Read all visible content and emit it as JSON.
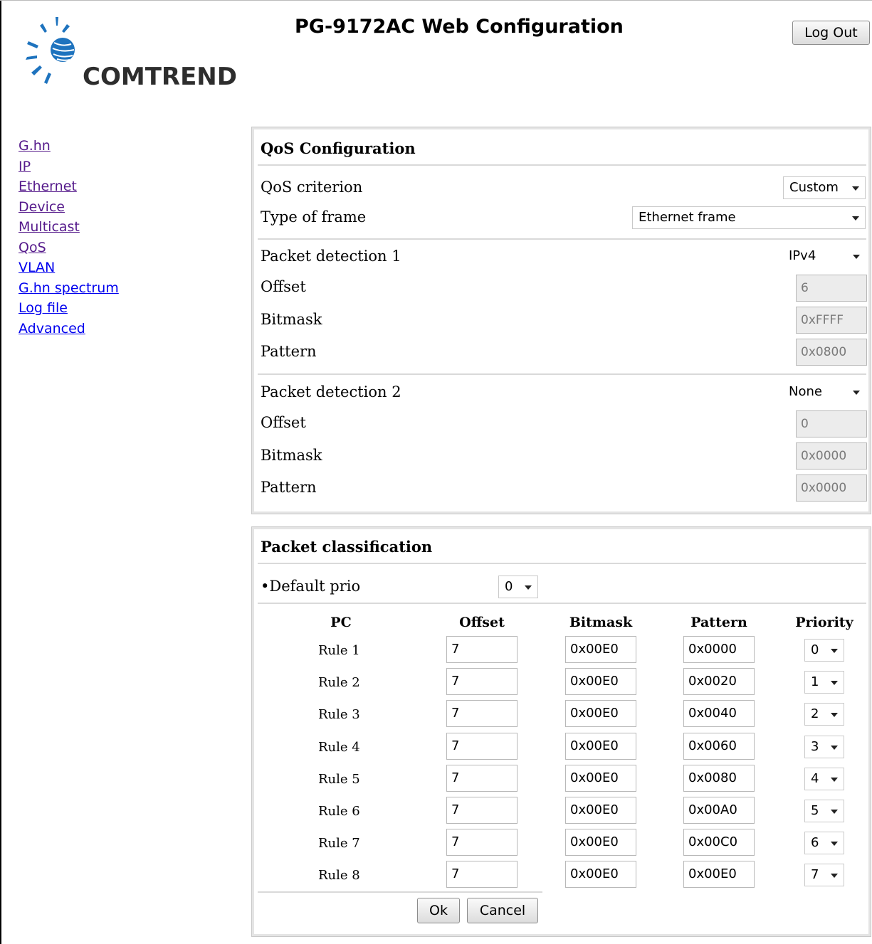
{
  "header": {
    "brand": "COMTREND",
    "title": "PG-9172AC Web Configuration",
    "logout_label": "Log Out"
  },
  "sidebar": {
    "items": [
      {
        "label": "G.hn"
      },
      {
        "label": "IP"
      },
      {
        "label": "Ethernet"
      },
      {
        "label": "Device"
      },
      {
        "label": "Multicast"
      },
      {
        "label": "QoS"
      },
      {
        "label": "VLAN"
      },
      {
        "label": "G.hn spectrum"
      },
      {
        "label": "Log file"
      },
      {
        "label": "Advanced"
      }
    ]
  },
  "qos": {
    "heading": "QoS Configuration",
    "criterion_label": "QoS criterion",
    "criterion_value": "Custom",
    "frame_label": "Type of frame",
    "frame_value": "Ethernet frame",
    "detection1": {
      "label": "Packet detection 1",
      "value": "IPv4",
      "offset_label": "Offset",
      "offset": "6",
      "bitmask_label": "Bitmask",
      "bitmask": "0xFFFF",
      "pattern_label": "Pattern",
      "pattern": "0x0800"
    },
    "detection2": {
      "label": "Packet detection 2",
      "value": "None",
      "offset_label": "Offset",
      "offset": "0",
      "bitmask_label": "Bitmask",
      "bitmask": "0x0000",
      "pattern_label": "Pattern",
      "pattern": "0x0000"
    }
  },
  "classification": {
    "heading": "Packet classification",
    "default_prio_label": "•Default prio",
    "default_prio_value": "0",
    "columns": [
      "PC",
      "Offset",
      "Bitmask",
      "Pattern",
      "Priority"
    ],
    "rules": [
      {
        "name": "Rule 1",
        "offset": "7",
        "bitmask": "0x00E0",
        "pattern": "0x0000",
        "priority": "0"
      },
      {
        "name": "Rule 2",
        "offset": "7",
        "bitmask": "0x00E0",
        "pattern": "0x0020",
        "priority": "1"
      },
      {
        "name": "Rule 3",
        "offset": "7",
        "bitmask": "0x00E0",
        "pattern": "0x0040",
        "priority": "2"
      },
      {
        "name": "Rule 4",
        "offset": "7",
        "bitmask": "0x00E0",
        "pattern": "0x0060",
        "priority": "3"
      },
      {
        "name": "Rule 5",
        "offset": "7",
        "bitmask": "0x00E0",
        "pattern": "0x0080",
        "priority": "4"
      },
      {
        "name": "Rule 6",
        "offset": "7",
        "bitmask": "0x00E0",
        "pattern": "0x00A0",
        "priority": "5"
      },
      {
        "name": "Rule 7",
        "offset": "7",
        "bitmask": "0x00E0",
        "pattern": "0x00C0",
        "priority": "6"
      },
      {
        "name": "Rule 8",
        "offset": "7",
        "bitmask": "0x00E0",
        "pattern": "0x00E0",
        "priority": "7"
      }
    ],
    "ok_label": "Ok",
    "cancel_label": "Cancel"
  },
  "colors": {
    "link_visited": "#551a8b",
    "link_unvisited": "#0000ee",
    "logo_blue": "#1e73be",
    "panel_border": "#c8c8c8"
  }
}
